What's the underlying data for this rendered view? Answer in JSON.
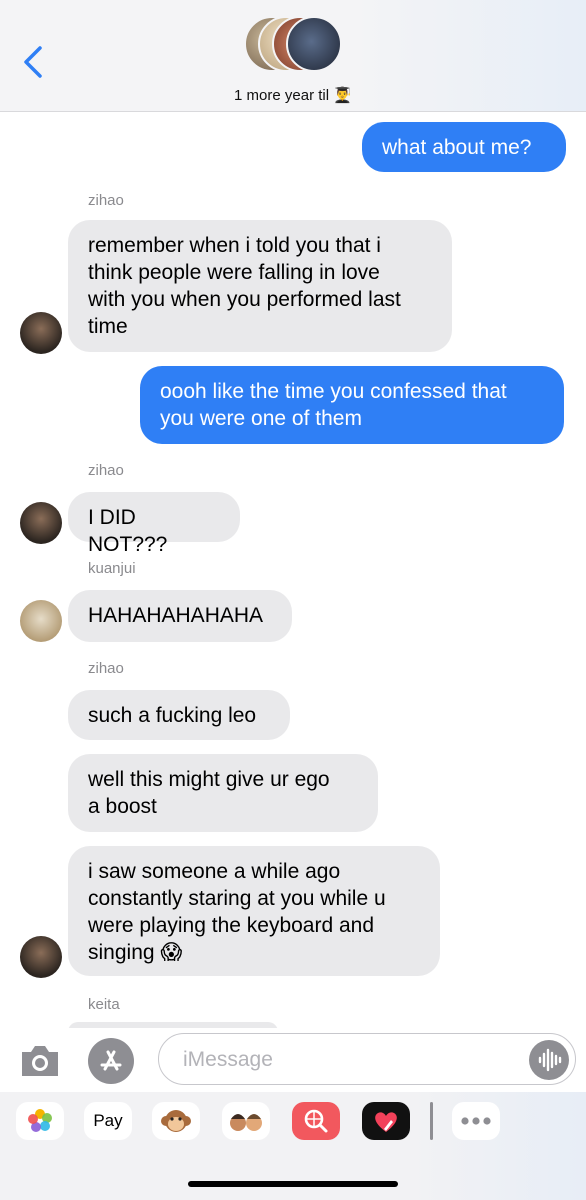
{
  "header": {
    "group_title": "1 more year til 👨‍🎓"
  },
  "messages": [
    {
      "direction": "out",
      "text": "what about me?"
    },
    {
      "sender": "zihao",
      "direction": "in",
      "text": "remember when i told you that i\nthink people were falling in love\nwith you when you performed last\ntime"
    },
    {
      "direction": "out",
      "text": "oooh like the time you confessed that\nyou were one of them"
    },
    {
      "sender": "zihao",
      "direction": "in",
      "text": "I DID NOT???"
    },
    {
      "sender": "kuanjui",
      "direction": "in",
      "text": "HAHAHAHAHAHA"
    },
    {
      "sender": "zihao",
      "direction": "in",
      "text": "such a fucking leo"
    },
    {
      "sender": "zihao",
      "direction": "in",
      "text": "well this might give ur ego\na boost"
    },
    {
      "sender": "zihao",
      "direction": "in",
      "text": "i saw someone a while ago\nconstantly staring at you while u\nwere playing the keyboard and\nsinging 😱"
    },
    {
      "sender": "keita",
      "direction": "in",
      "text": ""
    }
  ],
  "input": {
    "placeholder": "iMessage"
  },
  "tray": {
    "apple_pay_label": "Pay",
    "icons": [
      "photos-icon",
      "apple-pay-icon",
      "monkey-memoji-icon",
      "memoji-icon",
      "image-search-icon",
      "digital-touch-icon",
      "more-icon"
    ]
  },
  "colors": {
    "outgoing_bubble": "#2f7ff5",
    "incoming_bubble": "#e9e9eb",
    "accent": "#2f7ff5"
  }
}
